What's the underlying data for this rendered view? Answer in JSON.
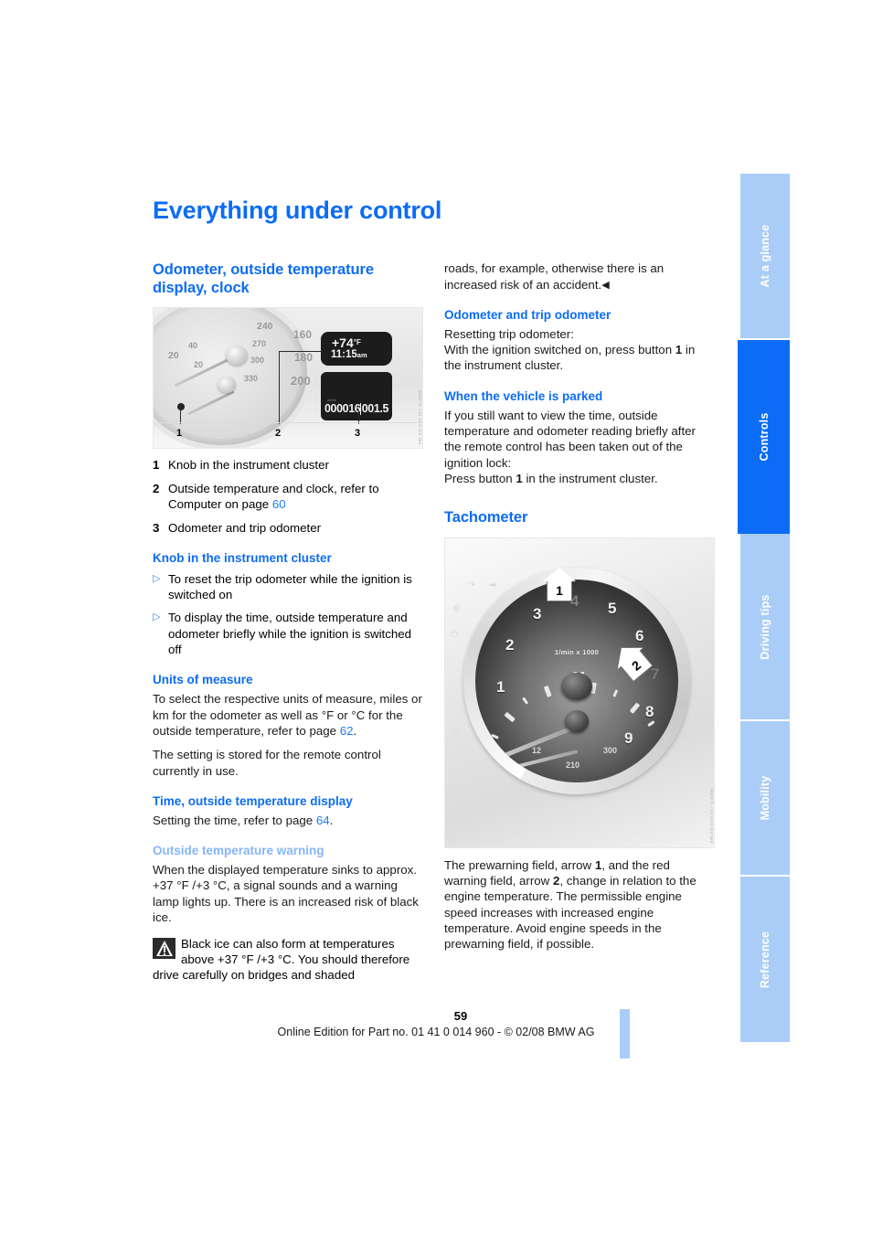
{
  "page_title": "Everything under control",
  "chapter_tabs": [
    {
      "label": "At a glance",
      "active": false
    },
    {
      "label": "Controls",
      "active": true
    },
    {
      "label": "Driving tips",
      "active": false
    },
    {
      "label": "Mobility",
      "active": false
    },
    {
      "label": "Reference",
      "active": false
    }
  ],
  "left_column": {
    "section_title": "Odometer, outside temperature display, clock",
    "figure": {
      "name": "instrument-cluster-photo",
      "display": {
        "temperature": "+74",
        "temperature_unit": "°F",
        "clock": "11:15",
        "clock_ampm": "am",
        "odometer": "000016",
        "trip_odometer": "001.5",
        "small_label": "miles"
      },
      "speedometer_numbers": [
        "20",
        "40",
        "20",
        "240",
        "270",
        "300",
        "330",
        "160",
        "180",
        "200"
      ],
      "callouts": [
        "1",
        "2",
        "3"
      ],
      "credit": "BMW TL / 01 00 0 014 960"
    },
    "legend": [
      {
        "num": "1",
        "text": "Knob in the instrument cluster"
      },
      {
        "num": "2",
        "text": "Outside temperature and clock, refer to Computer on page ",
        "pageref": "60"
      },
      {
        "num": "3",
        "text": "Odometer and trip odometer"
      }
    ],
    "knob_heading": "Knob in the instrument cluster",
    "knob_items": [
      "To reset the trip odometer while the ignition is switched on",
      "To display the time, outside temperature and odometer briefly while the ignition is switched off"
    ],
    "units_heading": "Units of measure",
    "units_p1_a": "To select the respective units of measure, miles or km for the odometer as well as °F  or °C for the outside temperature, refer to page ",
    "units_p1_ref": "62",
    "units_p1_b": ".",
    "units_p2": "The setting is stored for the remote control currently in use.",
    "time_heading": "Time, outside temperature display",
    "time_p1_a": "Setting the time, refer to page ",
    "time_p1_ref": "64",
    "time_p1_b": ".",
    "warning_heading": "Outside temperature warning",
    "warning_p1": "When the displayed temperature sinks to approx. +37 °F /+3 °C, a signal sounds and a warning lamp lights up. There is an increased risk of black ice.",
    "warning_note": "Black ice can also form at temperatures above +37 °F /+3 °C. You should therefore drive carefully on bridges and shaded"
  },
  "right_column": {
    "continuation": "roads, for example, otherwise there is an increased risk of an accident.",
    "continuation_endmark": "◀",
    "odo_heading": "Odometer and trip odometer",
    "odo_line1": "Resetting trip odometer:",
    "odo_line2_a": "With the ignition switched on, press button ",
    "odo_line2_bold": "1",
    "odo_line2_b": " in the instrument cluster.",
    "parked_heading": "When the vehicle is parked",
    "parked_p1": "If you still want to view the time, outside temperature and odometer reading briefly after the remote control has been taken out of the ignition lock:",
    "parked_p2_a": "Press button ",
    "parked_p2_bold": "1",
    "parked_p2_b": " in the instrument cluster.",
    "tacho_heading": "Tachometer",
    "figure": {
      "name": "tachometer-photo",
      "dial_numbers": [
        "1",
        "2",
        "3",
        "4",
        "5",
        "6",
        "7",
        "8",
        "9"
      ],
      "unit_label": "1/min x 1000",
      "brand_logo": "M",
      "oil_numbers": [
        "12",
        "210",
        "300"
      ],
      "callouts": [
        "1",
        "2"
      ],
      "credit": "BMW TL / 01 00 0 014 960"
    },
    "tacho_p1_a": "The prewarning field, arrow ",
    "tacho_p1_b1": "1",
    "tacho_p1_b": ", and the red warning field, arrow ",
    "tacho_p1_b2": "2",
    "tacho_p1_c": ", change in relation to the engine temperature. The permissible engine speed increases with increased engine temperature. Avoid engine speeds in the prewarning field, if possible."
  },
  "footer": {
    "page_number": "59",
    "line": "Online Edition for Part no. 01 41 0 014 960 - © 02/08 BMW AG"
  },
  "colors": {
    "heading_blue": "#0c6cf5",
    "light_blue": "#86b6f7",
    "tab_blue": "#aacdf8",
    "active_tab_blue": "#0c6cf5"
  }
}
